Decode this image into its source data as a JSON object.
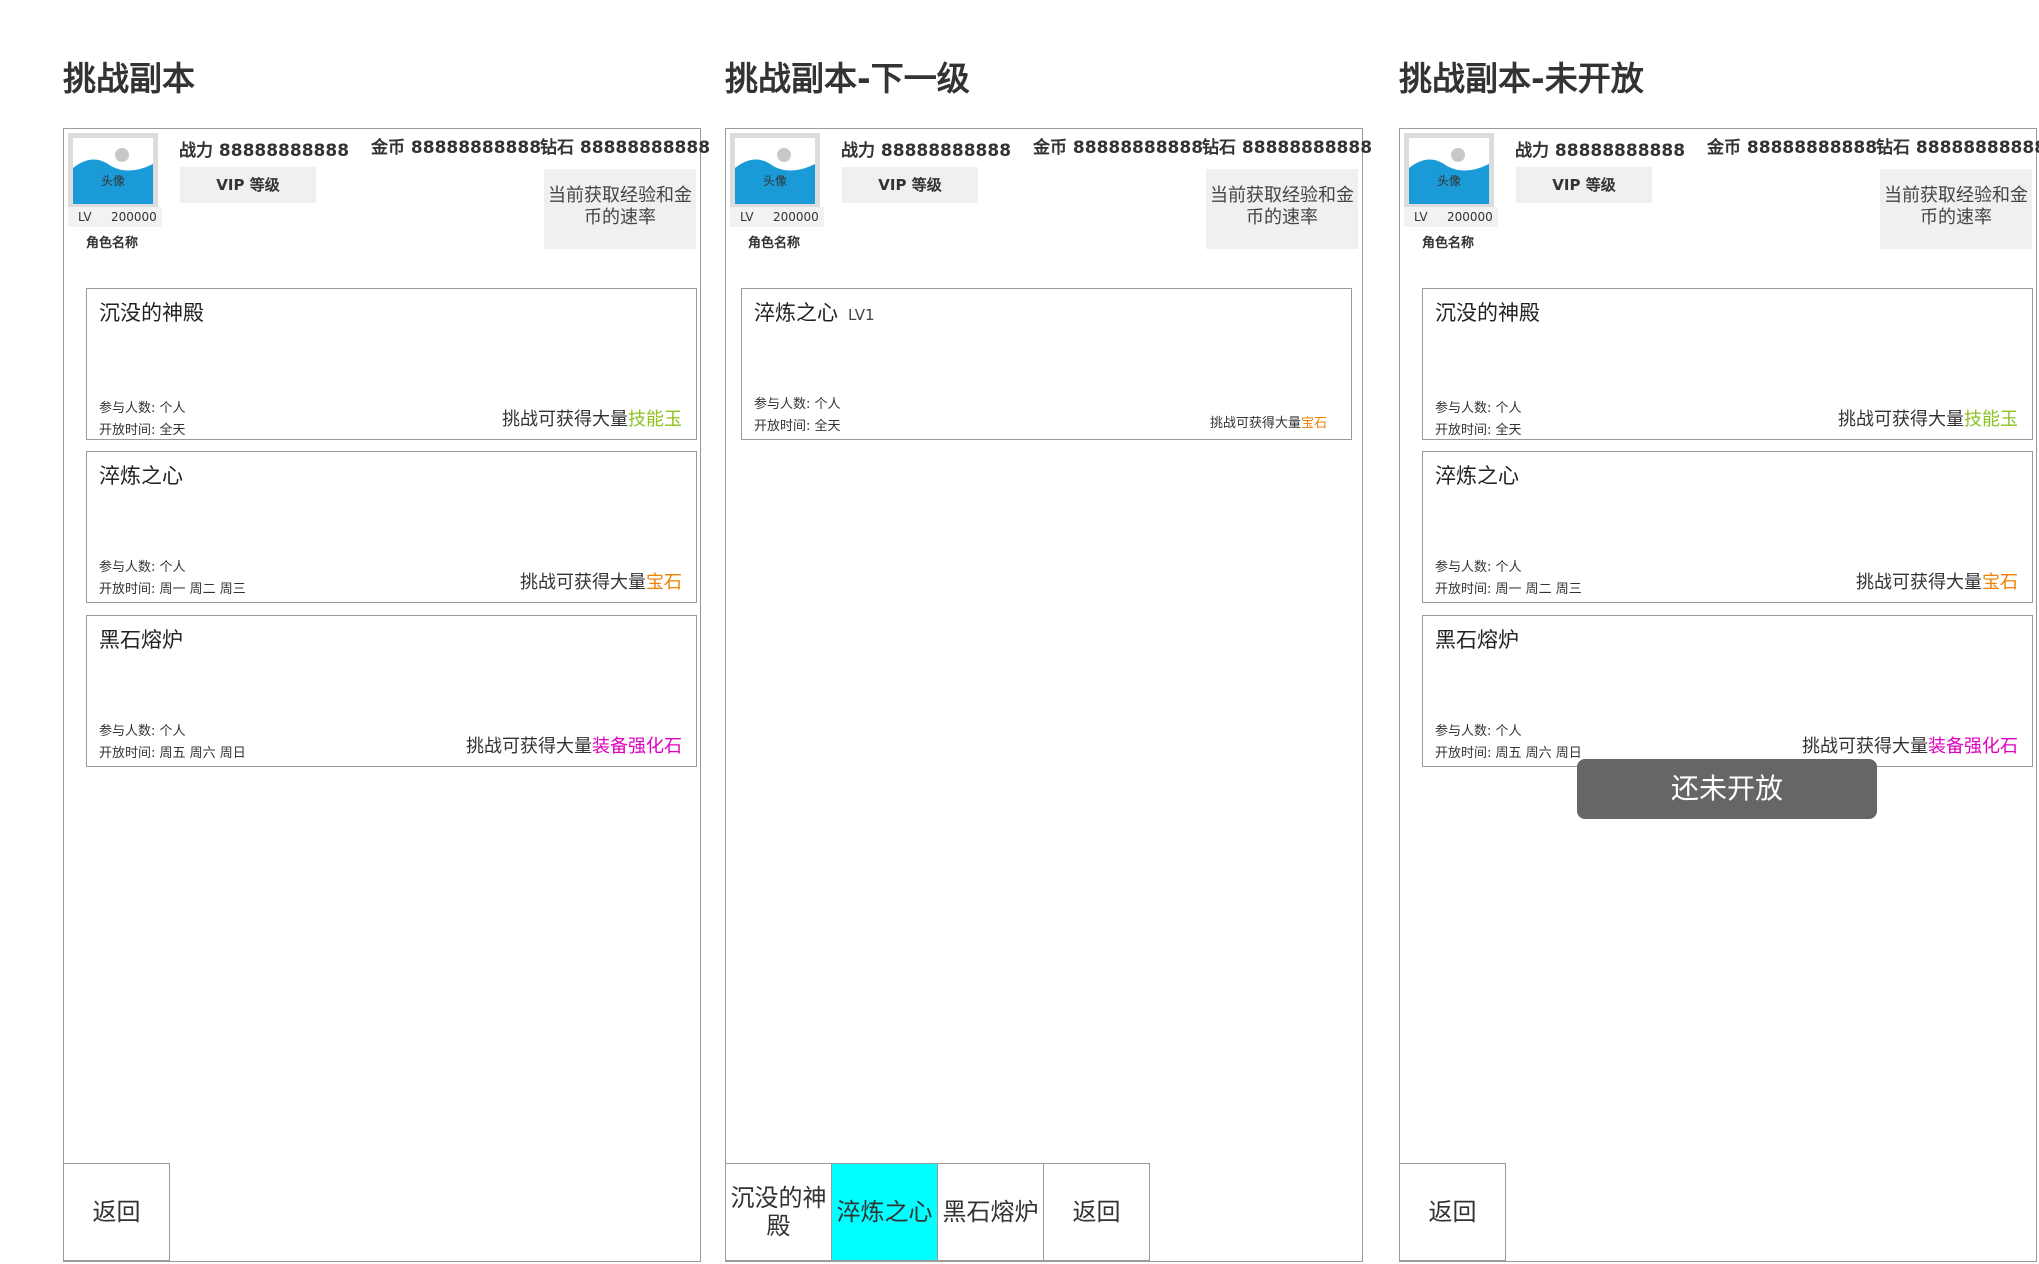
{
  "panels": [
    {
      "title": "挑战副本",
      "header": {
        "avatar_label": "头像",
        "lv_label": "LV",
        "lv_value": "200000",
        "role_name": "角色名称",
        "power": "战力 88888888888",
        "gold": "金币  88888888888",
        "diamond": "钻石  88888888888",
        "vip": "VIP 等级",
        "rate_line1": "当前获取经验和金",
        "rate_line2": "币的速率"
      },
      "cards": [
        {
          "name": "沉没的神殿",
          "participants": "参与人数: 个人",
          "open_time": "开放时间: 全天",
          "reward_prefix": "挑战可获得大量",
          "reward_item": "技能玉",
          "reward_color": "#8dc21f"
        },
        {
          "name": "淬炼之心",
          "participants": "参与人数: 个人",
          "open_time": "开放时间: 周一  周二  周三",
          "reward_prefix": "挑战可获得大量",
          "reward_item": "宝石",
          "reward_color": "#f08000"
        },
        {
          "name": "黑石熔炉",
          "participants": "参与人数: 个人",
          "open_time": "开放时间: 周五  周六  周日",
          "reward_prefix": "挑战可获得大量",
          "reward_item": "装备强化石",
          "reward_color": "#e000c0"
        }
      ],
      "back": "返回"
    },
    {
      "title": "挑战副本-下一级",
      "header": {
        "avatar_label": "头像",
        "lv_label": "LV",
        "lv_value": "200000",
        "role_name": "角色名称",
        "power": "战力 88888888888",
        "gold": "金币  88888888888",
        "diamond": "钻石  88888888888",
        "vip": "VIP 等级",
        "rate_line1": "当前获取经验和金",
        "rate_line2": "币的速率"
      },
      "card": {
        "name": "淬炼之心",
        "level": "LV1",
        "participants": "参与人数: 个人",
        "open_time": "开放时间: 全天",
        "reward_prefix": "挑战可获得大量",
        "reward_item": "宝石",
        "reward_color": "#f08000"
      },
      "tabs": [
        {
          "label_line1": "沉没的神",
          "label_line2": "殿",
          "active": false
        },
        {
          "label_line1": "淬炼之心",
          "label_line2": "",
          "active": true
        },
        {
          "label_line1": "黑石熔炉",
          "label_line2": "",
          "active": false
        }
      ],
      "active_color": "#00ffff",
      "back": "返回"
    },
    {
      "title": "挑战副本-未开放",
      "header": {
        "avatar_label": "头像",
        "lv_label": "LV",
        "lv_value": "200000",
        "role_name": "角色名称",
        "power": "战力 88888888888",
        "gold": "金币  88888888888",
        "diamond": "钻石  88888888888",
        "vip": "VIP 等级",
        "rate_line1": "当前获取经验和金",
        "rate_line2": "币的速率"
      },
      "cards": [
        {
          "name": "沉没的神殿",
          "participants": "参与人数: 个人",
          "open_time": "开放时间: 全天",
          "reward_prefix": "挑战可获得大量",
          "reward_item": "技能玉",
          "reward_color": "#8dc21f"
        },
        {
          "name": "淬炼之心",
          "participants": "参与人数: 个人",
          "open_time": "开放时间: 周一  周二  周三",
          "reward_prefix": "挑战可获得大量",
          "reward_item": "宝石",
          "reward_color": "#f08000"
        },
        {
          "name": "黑石熔炉",
          "participants": "参与人数: 个人",
          "open_time": "开放时间: 周五  周六  周日",
          "reward_prefix": "挑战可获得大量",
          "reward_item": "装备强化石",
          "reward_color": "#e000c0"
        }
      ],
      "toast": "还未开放",
      "back": "返回"
    }
  ],
  "colors": {
    "avatar_blue": "#1a9ad6",
    "border": "#9a9a9a"
  }
}
